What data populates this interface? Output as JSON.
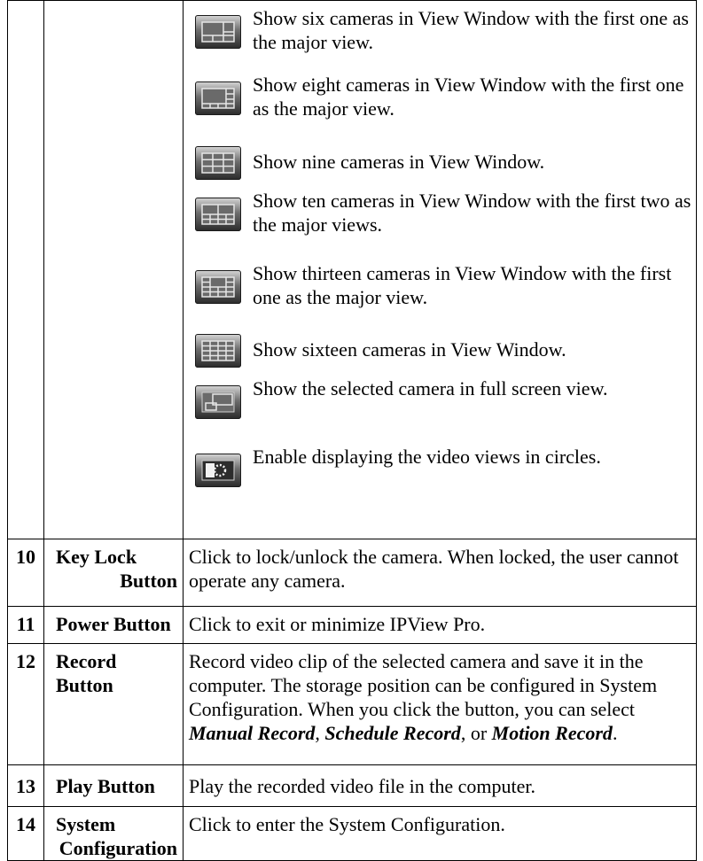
{
  "view_modes": [
    {
      "icon": "six-camera-layout-icon",
      "text": "Show six cameras in View Window with the first one as the major view."
    },
    {
      "icon": "eight-camera-layout-icon",
      "text": "Show eight cameras in View Window with the first one as the major view."
    },
    {
      "icon": "nine-camera-layout-icon",
      "text": "Show nine cameras in View Window."
    },
    {
      "icon": "ten-camera-layout-icon",
      "text": "Show ten cameras in View Window with the first two as the major views."
    },
    {
      "icon": "thirteen-camera-layout-icon",
      "text": "Show thirteen cameras in View Window with the first one as the major view."
    },
    {
      "icon": "sixteen-camera-layout-icon",
      "text": "Show sixteen cameras in View Window."
    },
    {
      "icon": "full-screen-icon",
      "text": "Show the selected camera in full screen view."
    },
    {
      "icon": "circle-view-icon",
      "text": "Enable displaying the video views in circles."
    }
  ],
  "rows": {
    "r10": {
      "num": "10",
      "name_line1": "Key Lock",
      "name_line2": "Button",
      "desc": "Click to lock/unlock the camera. When locked, the user cannot operate any camera."
    },
    "r11": {
      "num": "11",
      "name": "Power Button",
      "desc": "Click to exit or minimize IPView Pro."
    },
    "r12": {
      "num": "12",
      "name": "Record Button",
      "desc_main": "Record video clip of the selected camera and save it in the computer. The storage position can be configured in System Configuration. When you click the button, you can select ",
      "opt1": "Manual Record",
      "sep1": ", ",
      "opt2": "Schedule Record",
      "sep2": ", or ",
      "opt3": "Motion Record",
      "end": "."
    },
    "r13": {
      "num": "13",
      "name": "Play Button",
      "desc": "Play the recorded video file in the computer."
    },
    "r14": {
      "num": "14",
      "name_line1": "System",
      "name_line2": "Configuration",
      "desc": "Click to enter the System Configuration."
    }
  }
}
